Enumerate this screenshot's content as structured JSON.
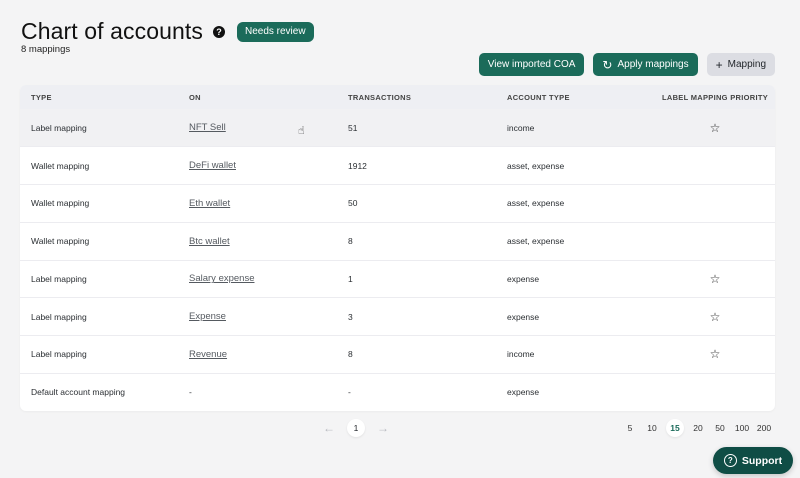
{
  "header": {
    "title": "Chart of accounts",
    "help_icon": "?",
    "badge": "Needs review",
    "subtitle": "8 mappings"
  },
  "actions": {
    "view_coa": "View imported COA",
    "apply_icon": "refresh-icon",
    "apply": "Apply mappings",
    "add_icon": "plus-icon",
    "add": "Mapping"
  },
  "table": {
    "columns": [
      "TYPE",
      "ON",
      "TRANSACTIONS",
      "ACCOUNT TYPE",
      "LABEL MAPPING PRIORITY"
    ],
    "rows": [
      {
        "type": "Label mapping",
        "on": "NFT Sell",
        "transactions": "51",
        "account_type": "income",
        "star": "☆"
      },
      {
        "type": "Wallet mapping",
        "on": "DeFi wallet",
        "transactions": "1912",
        "account_type": "asset, expense",
        "star": ""
      },
      {
        "type": "Wallet mapping",
        "on": "Eth wallet",
        "transactions": "50",
        "account_type": "asset, expense",
        "star": ""
      },
      {
        "type": "Wallet mapping",
        "on": "Btc wallet",
        "transactions": "8",
        "account_type": "asset, expense",
        "star": ""
      },
      {
        "type": "Label mapping",
        "on": "Salary expense",
        "transactions": "1",
        "account_type": "expense",
        "star": "☆"
      },
      {
        "type": "Label mapping",
        "on": "Expense",
        "transactions": "3",
        "account_type": "expense",
        "star": "☆"
      },
      {
        "type": "Label mapping",
        "on": "Revenue",
        "transactions": "8",
        "account_type": "income",
        "star": "☆"
      },
      {
        "type": "Default account mapping",
        "on": "-",
        "transactions": "-",
        "account_type": "expense",
        "star": ""
      }
    ]
  },
  "pagination": {
    "prev": "←",
    "current_page": "1",
    "next": "→",
    "page_sizes": [
      "5",
      "10",
      "15",
      "20",
      "50",
      "100",
      "200"
    ],
    "active_size": "15"
  },
  "support": {
    "icon": "?",
    "label": "Support"
  },
  "colors": {
    "primary": "#1b6b5a",
    "support": "#0f4d45",
    "background": "#f4f4f5"
  }
}
